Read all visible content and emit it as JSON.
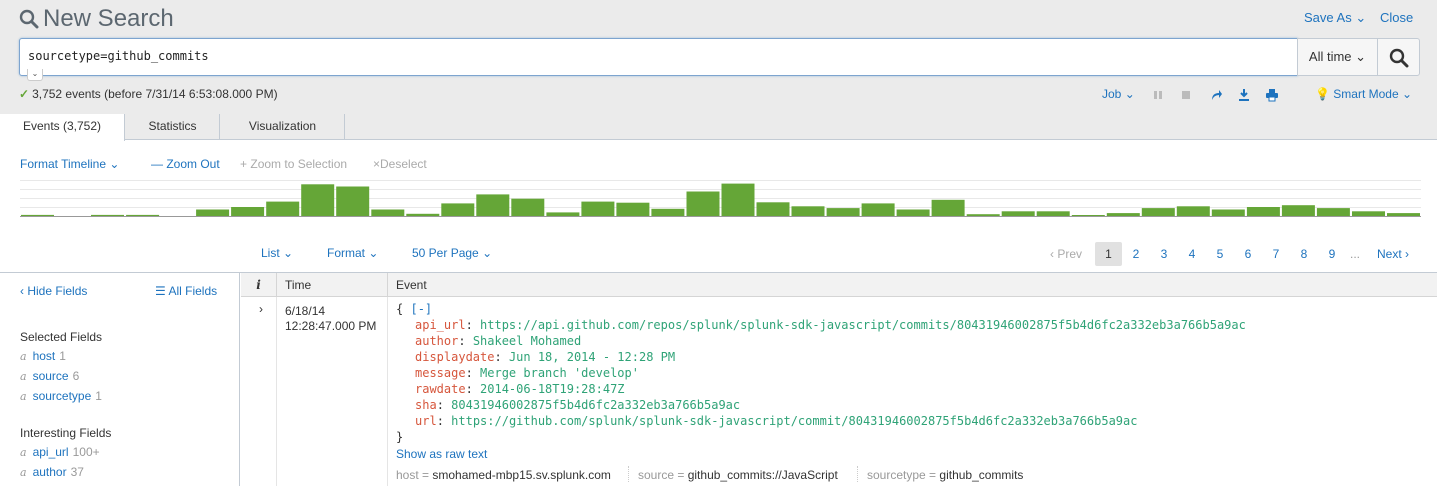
{
  "header": {
    "title": "New Search",
    "save_as": "Save As",
    "close": "Close"
  },
  "search": {
    "query": "sourcetype=github_commits",
    "time_range": "All time"
  },
  "status": {
    "text": "3,752 events (before 7/31/14 6:53:08.000 PM)"
  },
  "job_toolbar": {
    "job": "Job",
    "mode": "Smart Mode"
  },
  "tabs": [
    {
      "label": "Events (3,752)"
    },
    {
      "label": "Statistics"
    },
    {
      "label": "Visualization"
    }
  ],
  "timeline_controls": {
    "format": "Format Timeline",
    "zoom_out": "Zoom Out",
    "zoom_selection": "Zoom to Selection",
    "deselect": "Deselect"
  },
  "timeline": {
    "bar_color": "#65a637",
    "bars": [
      0.03,
      0,
      0.03,
      0.03,
      0,
      0.18,
      0.25,
      0.4,
      0.88,
      0.82,
      0.18,
      0.06,
      0.35,
      0.6,
      0.48,
      0.1,
      0.4,
      0.37,
      0.2,
      0.68,
      0.9,
      0.38,
      0.27,
      0.22,
      0.35,
      0.18,
      0.45,
      0.05,
      0.13,
      0.13,
      0.02,
      0.08,
      0.22,
      0.27,
      0.18,
      0.25,
      0.3,
      0.22,
      0.13,
      0.08
    ]
  },
  "results_controls": {
    "list": "List",
    "format": "Format",
    "per_page": "50 Per Page"
  },
  "pager": {
    "prev": "Prev",
    "current": "1",
    "pages": [
      "2",
      "3",
      "4",
      "5",
      "6",
      "7",
      "8",
      "9"
    ],
    "ellipsis": "...",
    "next": "Next"
  },
  "sidebar": {
    "hide_fields": "Hide Fields",
    "all_fields": "All Fields",
    "selected_heading": "Selected Fields",
    "selected": [
      {
        "type": "a",
        "name": "host",
        "count": "1"
      },
      {
        "type": "a",
        "name": "source",
        "count": "6"
      },
      {
        "type": "a",
        "name": "sourcetype",
        "count": "1"
      }
    ],
    "interesting_heading": "Interesting Fields",
    "interesting": [
      {
        "type": "a",
        "name": "api_url",
        "count": "100+"
      },
      {
        "type": "a",
        "name": "author",
        "count": "37"
      }
    ]
  },
  "table": {
    "col_i": "i",
    "col_time": "Time",
    "col_event": "Event"
  },
  "event": {
    "date": "6/18/14",
    "time": "12:28:47.000 PM",
    "open_brace": "{",
    "collapse": "[-]",
    "close_brace": "}",
    "fields": [
      {
        "key": "api_url",
        "value": "https://api.github.com/repos/splunk/splunk-sdk-javascript/commits/80431946002875f5b4d6fc2a332eb3a766b5a9ac"
      },
      {
        "key": "author",
        "value": "Shakeel Mohamed"
      },
      {
        "key": "displaydate",
        "value": "Jun 18, 2014 - 12:28 PM"
      },
      {
        "key": "message",
        "value": "Merge branch 'develop'"
      },
      {
        "key": "rawdate",
        "value": "2014-06-18T19:28:47Z"
      },
      {
        "key": "sha",
        "value": "80431946002875f5b4d6fc2a332eb3a766b5a9ac"
      },
      {
        "key": "url",
        "value": "https://github.com/splunk/splunk-sdk-javascript/commit/80431946002875f5b4d6fc2a332eb3a766b5a9ac"
      }
    ],
    "show_raw": "Show as raw text",
    "meta": [
      {
        "key": "host",
        "value": "smohamed-mbp15.sv.splunk.com"
      },
      {
        "key": "source",
        "value": "github_commits://JavaScript"
      },
      {
        "key": "sourcetype",
        "value": "github_commits"
      }
    ]
  }
}
